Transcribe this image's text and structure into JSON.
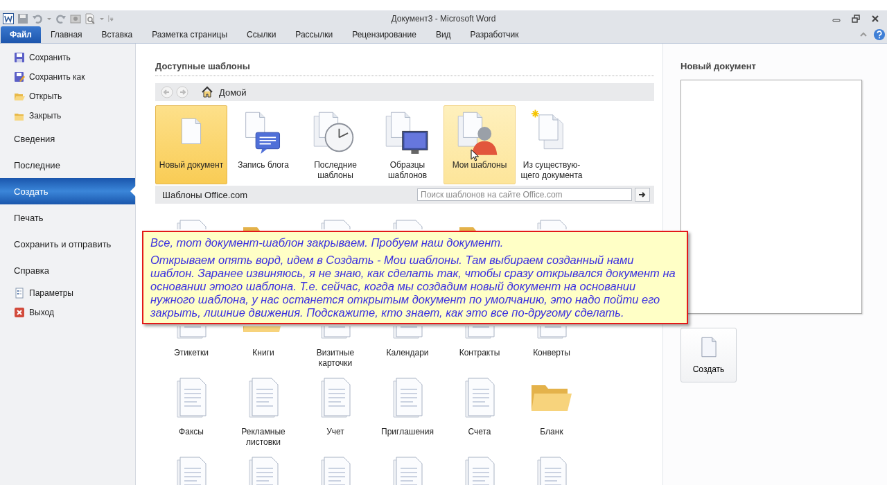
{
  "window": {
    "title": "Документ3 - Microsoft Word"
  },
  "ribbon_tabs": [
    {
      "label": "Файл",
      "selected": true,
      "kind": "file"
    },
    {
      "label": "Главная",
      "selected": false,
      "kind": "tab"
    },
    {
      "label": "Вставка",
      "selected": false,
      "kind": "tab"
    },
    {
      "label": "Разметка страницы",
      "selected": false,
      "kind": "tab"
    },
    {
      "label": "Ссылки",
      "selected": false,
      "kind": "tab"
    },
    {
      "label": "Рассылки",
      "selected": false,
      "kind": "tab"
    },
    {
      "label": "Рецензирование",
      "selected": false,
      "kind": "tab"
    },
    {
      "label": "Вид",
      "selected": false,
      "kind": "tab"
    },
    {
      "label": "Разработчик",
      "selected": false,
      "kind": "tab"
    }
  ],
  "sidebar": {
    "items": [
      {
        "kind": "command",
        "label": "Сохранить",
        "selected": false
      },
      {
        "kind": "command",
        "label": "Сохранить как",
        "selected": false
      },
      {
        "kind": "command",
        "label": "Открыть",
        "selected": false
      },
      {
        "kind": "command",
        "label": "Закрыть",
        "selected": false
      },
      {
        "kind": "section",
        "label": "Сведения",
        "selected": false
      },
      {
        "kind": "section",
        "label": "Последние",
        "selected": false
      },
      {
        "kind": "section",
        "label": "Создать",
        "selected": true
      },
      {
        "kind": "section",
        "label": "Печать",
        "selected": false
      },
      {
        "kind": "section",
        "label": "Сохранить и отправить",
        "selected": false
      },
      {
        "kind": "section",
        "label": "Справка",
        "selected": false
      },
      {
        "kind": "command",
        "label": "Параметры",
        "selected": false
      },
      {
        "kind": "command",
        "label": "Выход",
        "selected": false
      }
    ]
  },
  "templates": {
    "heading": "Доступные шаблоны",
    "location": "Домой",
    "featured": [
      {
        "label": "Новый документ",
        "selected": true,
        "hovered": false
      },
      {
        "label": "Запись блога",
        "selected": false,
        "hovered": false
      },
      {
        "label": "Последние шаблоны",
        "selected": false,
        "hovered": false
      },
      {
        "label": "Образцы шаблонов",
        "selected": false,
        "hovered": false
      },
      {
        "label": "Мои шаблоны",
        "selected": false,
        "hovered": true
      },
      {
        "label": "Из существую-щего документа",
        "selected": false,
        "hovered": false
      }
    ],
    "office_label": "Шаблоны Office.com",
    "search_placeholder": "Поиск шаблонов на сайте Office.com",
    "office_items": [
      {
        "kind": "doc"
      },
      {
        "kind": "folder"
      },
      {
        "kind": "doc"
      },
      {
        "kind": "doc"
      },
      {
        "kind": "folder"
      },
      {
        "kind": "doc"
      },
      {
        "kind": "doc",
        "label": "Этикетки"
      },
      {
        "kind": "folder",
        "label": "Книги"
      },
      {
        "kind": "doc",
        "label": "Визитные карточки"
      },
      {
        "kind": "doc",
        "label": "Календари"
      },
      {
        "kind": "doc",
        "label": "Контракты"
      },
      {
        "kind": "doc",
        "label": "Конверты"
      },
      {
        "kind": "doc",
        "label": "Факсы"
      },
      {
        "kind": "doc",
        "label": "Рекламные листовки"
      },
      {
        "kind": "doc",
        "label": "Учет"
      },
      {
        "kind": "doc",
        "label": "Приглашения"
      },
      {
        "kind": "doc",
        "label": "Счета"
      },
      {
        "kind": "folder",
        "label": "Бланк"
      },
      {
        "kind": "doc"
      },
      {
        "kind": "doc"
      },
      {
        "kind": "doc"
      },
      {
        "kind": "doc"
      },
      {
        "kind": "doc"
      },
      {
        "kind": "doc"
      }
    ]
  },
  "note": {
    "paragraphs": [
      "Все, тот документ-шаблон закрываем. Пробуем наш документ.",
      "Открываем опять ворд, идем в Создать - Мои шаблоны. Там выбираем созданный нами шаблон. Заранее извиняюсь, я не знаю, как сделать так, чтобы сразу открывался документ на основании этого шаблона. Т.е. сейчас, когда мы создадим новый документ на основании нужного шаблона, у нас останется открытым документ по умолчанию, это надо пойти его закрыть, лишние движения. Подскажите, кто знает, как это все по-другому сделать."
    ]
  },
  "preview": {
    "heading": "Новый документ",
    "create_button": "Создать"
  }
}
